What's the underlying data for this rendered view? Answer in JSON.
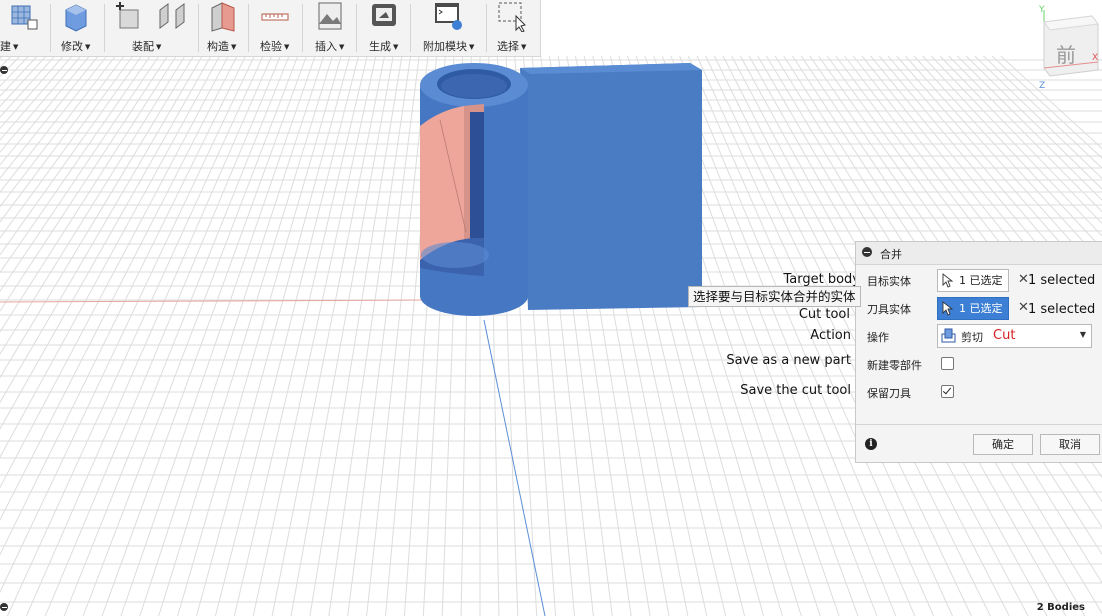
{
  "toolbar": {
    "groups": [
      {
        "label": "建",
        "icon": "create-icon"
      },
      {
        "label": "修改",
        "icon": "modify-icon"
      },
      {
        "label": "装配",
        "icon": "assemble-icon"
      },
      {
        "label": "构造",
        "icon": "construct-icon"
      },
      {
        "label": "检验",
        "icon": "inspect-icon"
      },
      {
        "label": "插入",
        "icon": "insert-icon"
      },
      {
        "label": "生成",
        "icon": "make-icon"
      },
      {
        "label": "附加模块",
        "icon": "addins-icon"
      },
      {
        "label": "选择",
        "icon": "select-icon"
      }
    ]
  },
  "viewcube": {
    "face_label": "前",
    "axis_x": "X",
    "axis_y": "Y",
    "axis_z": "Z"
  },
  "annotations": {
    "target_body": "Target body",
    "cut_tool": "Cut tool",
    "action": "Action",
    "save_new_part": "Save as a new part",
    "save_cut_tool": "Save the cut tool"
  },
  "tooltip": "选择要与目标实体合并的实体",
  "dialog": {
    "title": "合并",
    "target_label": "目标实体",
    "target_value": "1 已选定",
    "target_count": "1 selected",
    "tool_label": "刀具实体",
    "tool_value": "1 已选定",
    "tool_count": "1 selected",
    "clear_symbol": "✕",
    "operation_label": "操作",
    "operation_value": "剪切",
    "operation_value_en": "Cut",
    "new_component_label": "新建零部件",
    "new_component_checked": false,
    "keep_tools_label": "保留刀具",
    "keep_tools_checked": true,
    "ok_label": "确定",
    "cancel_label": "取消",
    "info_symbol": "i"
  },
  "status": {
    "bodies": "2 Bodies"
  },
  "colors": {
    "body_blue": "#4a7cc4",
    "cut_pink": "#eea59a",
    "selection_blue": "#3d7fd4",
    "cut_text_red": "#d62020",
    "grid_line": "#dcdcdc"
  }
}
